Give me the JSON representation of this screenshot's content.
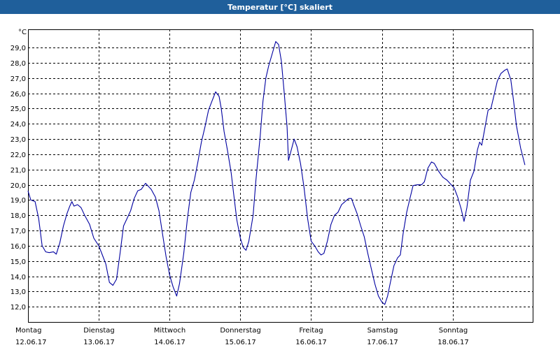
{
  "window": {
    "title": "Temperatur [°C] skaliert"
  },
  "chart_data": {
    "type": "line",
    "title": "Temperatur [°C] skaliert",
    "ylabel": "°C",
    "xlabel": "",
    "grid": true,
    "ylim": [
      11.0,
      30.2
    ],
    "xlim": [
      0,
      7.13
    ],
    "y_ticks": [
      12.0,
      13.0,
      14.0,
      15.0,
      16.0,
      17.0,
      18.0,
      19.0,
      20.0,
      21.0,
      22.0,
      23.0,
      24.0,
      25.0,
      26.0,
      27.0,
      28.0,
      29.0
    ],
    "y_tick_labels": [
      "12,0",
      "13,0",
      "14,0",
      "15,0",
      "16,0",
      "17,0",
      "18,0",
      "19,0",
      "20,0",
      "21,0",
      "22,0",
      "23,0",
      "24,0",
      "25,0",
      "26,0",
      "27,0",
      "28,0",
      "29,0"
    ],
    "x_ticks": [
      0,
      1,
      2,
      3,
      4,
      5,
      6
    ],
    "x_tick_labels": [
      {
        "day": "Montag",
        "date": "12.06.17"
      },
      {
        "day": "Dienstag",
        "date": "13.06.17"
      },
      {
        "day": "Mittwoch",
        "date": "14.06.17"
      },
      {
        "day": "Donnerstag",
        "date": "15.06.17"
      },
      {
        "day": "Freitag",
        "date": "16.06.17"
      },
      {
        "day": "Samstag",
        "date": "17.06.17"
      },
      {
        "day": "Sonntag",
        "date": "18.06.17"
      }
    ],
    "series": [
      {
        "color": "#0000a0",
        "points": [
          [
            0.0,
            19.6
          ],
          [
            0.04,
            19.0
          ],
          [
            0.1,
            18.9
          ],
          [
            0.15,
            17.8
          ],
          [
            0.2,
            16.0
          ],
          [
            0.25,
            15.6
          ],
          [
            0.3,
            15.55
          ],
          [
            0.36,
            15.6
          ],
          [
            0.4,
            15.45
          ],
          [
            0.45,
            16.2
          ],
          [
            0.5,
            17.3
          ],
          [
            0.55,
            18.1
          ],
          [
            0.59,
            18.6
          ],
          [
            0.62,
            18.9
          ],
          [
            0.65,
            18.6
          ],
          [
            0.7,
            18.7
          ],
          [
            0.75,
            18.5
          ],
          [
            0.8,
            18.0
          ],
          [
            0.87,
            17.4
          ],
          [
            0.93,
            16.5
          ],
          [
            1.0,
            16.0
          ],
          [
            1.05,
            15.4
          ],
          [
            1.1,
            14.8
          ],
          [
            1.15,
            13.6
          ],
          [
            1.2,
            13.4
          ],
          [
            1.25,
            13.8
          ],
          [
            1.3,
            15.5
          ],
          [
            1.35,
            17.3
          ],
          [
            1.4,
            17.8
          ],
          [
            1.45,
            18.3
          ],
          [
            1.5,
            19.1
          ],
          [
            1.55,
            19.6
          ],
          [
            1.6,
            19.7
          ],
          [
            1.66,
            20.1
          ],
          [
            1.7,
            19.9
          ],
          [
            1.74,
            19.7
          ],
          [
            1.8,
            19.2
          ],
          [
            1.85,
            18.3
          ],
          [
            1.9,
            16.8
          ],
          [
            1.95,
            15.3
          ],
          [
            2.0,
            14.1
          ],
          [
            2.05,
            13.3
          ],
          [
            2.1,
            12.7
          ],
          [
            2.14,
            13.5
          ],
          [
            2.2,
            15.5
          ],
          [
            2.25,
            17.7
          ],
          [
            2.3,
            19.5
          ],
          [
            2.35,
            20.3
          ],
          [
            2.4,
            21.5
          ],
          [
            2.45,
            22.8
          ],
          [
            2.5,
            23.8
          ],
          [
            2.55,
            24.9
          ],
          [
            2.6,
            25.5
          ],
          [
            2.65,
            26.1
          ],
          [
            2.7,
            25.8
          ],
          [
            2.73,
            25.0
          ],
          [
            2.77,
            23.5
          ],
          [
            2.82,
            22.2
          ],
          [
            2.87,
            20.8
          ],
          [
            2.9,
            19.6
          ],
          [
            2.95,
            17.7
          ],
          [
            3.0,
            16.5
          ],
          [
            3.04,
            15.9
          ],
          [
            3.08,
            15.7
          ],
          [
            3.12,
            16.3
          ],
          [
            3.18,
            18.0
          ],
          [
            3.22,
            20.3
          ],
          [
            3.28,
            23.2
          ],
          [
            3.32,
            25.5
          ],
          [
            3.36,
            27.0
          ],
          [
            3.4,
            27.8
          ],
          [
            3.45,
            28.6
          ],
          [
            3.5,
            29.4
          ],
          [
            3.54,
            29.2
          ],
          [
            3.58,
            28.1
          ],
          [
            3.62,
            26.0
          ],
          [
            3.66,
            23.8
          ],
          [
            3.68,
            21.6
          ],
          [
            3.72,
            22.3
          ],
          [
            3.76,
            23.0
          ],
          [
            3.8,
            22.5
          ],
          [
            3.85,
            21.4
          ],
          [
            3.9,
            19.8
          ],
          [
            3.95,
            17.8
          ],
          [
            4.0,
            16.3
          ],
          [
            4.05,
            16.0
          ],
          [
            4.1,
            15.6
          ],
          [
            4.14,
            15.4
          ],
          [
            4.18,
            15.5
          ],
          [
            4.23,
            16.3
          ],
          [
            4.28,
            17.4
          ],
          [
            4.33,
            18.0
          ],
          [
            4.38,
            18.2
          ],
          [
            4.43,
            18.7
          ],
          [
            4.48,
            18.9
          ],
          [
            4.53,
            19.1
          ],
          [
            4.57,
            19.1
          ],
          [
            4.6,
            18.7
          ],
          [
            4.65,
            18.1
          ],
          [
            4.7,
            17.3
          ],
          [
            4.75,
            16.6
          ],
          [
            4.8,
            15.5
          ],
          [
            4.85,
            14.5
          ],
          [
            4.9,
            13.5
          ],
          [
            4.95,
            12.7
          ],
          [
            5.0,
            12.3
          ],
          [
            5.04,
            12.15
          ],
          [
            5.08,
            12.7
          ],
          [
            5.12,
            13.6
          ],
          [
            5.17,
            14.7
          ],
          [
            5.22,
            15.2
          ],
          [
            5.26,
            15.4
          ],
          [
            5.3,
            16.8
          ],
          [
            5.35,
            18.2
          ],
          [
            5.4,
            19.2
          ],
          [
            5.44,
            19.95
          ],
          [
            5.5,
            20.0
          ],
          [
            5.56,
            20.0
          ],
          [
            5.6,
            20.2
          ],
          [
            5.65,
            21.1
          ],
          [
            5.7,
            21.5
          ],
          [
            5.74,
            21.4
          ],
          [
            5.8,
            20.9
          ],
          [
            5.86,
            20.5
          ],
          [
            5.92,
            20.3
          ],
          [
            5.98,
            20.0
          ],
          [
            6.02,
            19.8
          ],
          [
            6.07,
            19.2
          ],
          [
            6.12,
            18.4
          ],
          [
            6.16,
            17.6
          ],
          [
            6.2,
            18.5
          ],
          [
            6.25,
            20.3
          ],
          [
            6.3,
            20.9
          ],
          [
            6.35,
            22.3
          ],
          [
            6.38,
            22.8
          ],
          [
            6.41,
            22.6
          ],
          [
            6.45,
            23.6
          ],
          [
            6.5,
            24.9
          ],
          [
            6.54,
            25.0
          ],
          [
            6.58,
            25.8
          ],
          [
            6.63,
            26.8
          ],
          [
            6.68,
            27.3
          ],
          [
            6.73,
            27.5
          ],
          [
            6.77,
            27.6
          ],
          [
            6.82,
            26.9
          ],
          [
            6.86,
            25.5
          ],
          [
            6.9,
            23.9
          ],
          [
            6.96,
            22.4
          ],
          [
            7.02,
            21.3
          ]
        ]
      }
    ]
  }
}
